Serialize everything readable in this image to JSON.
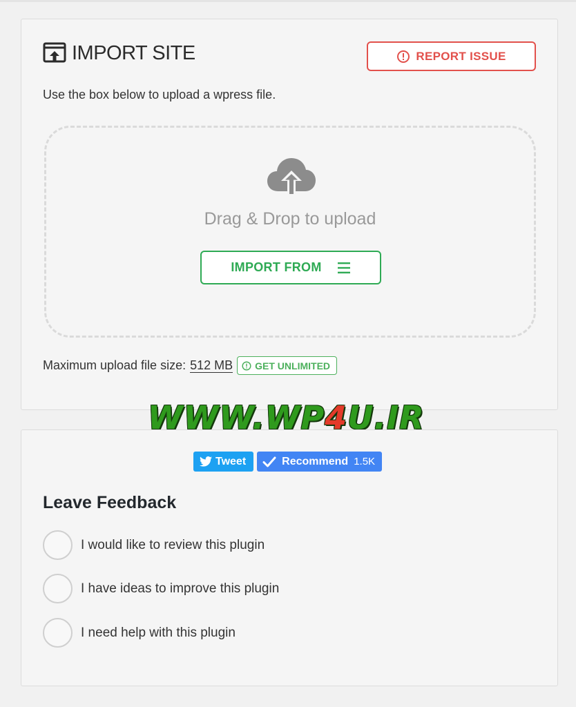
{
  "import": {
    "title": "IMPORT SITE",
    "report_issue_label": "REPORT ISSUE",
    "instructions": "Use the box below to upload a wpress file.",
    "dropzone_text": "Drag & Drop to upload",
    "import_from_label": "IMPORT FROM",
    "max_size_label": "Maximum upload file size:",
    "max_size_value": "512 MB",
    "get_unlimited_label": "GET UNLIMITED"
  },
  "watermark": {
    "text_a": "WWW.WP",
    "text_b": "4",
    "text_c": "U.IR"
  },
  "social": {
    "tweet_label": "Tweet",
    "recommend_label": "Recommend",
    "recommend_count": "1.5K"
  },
  "feedback": {
    "title": "Leave Feedback",
    "options": [
      {
        "label": "I would like to review this plugin"
      },
      {
        "label": "I have ideas to improve this plugin"
      },
      {
        "label": "I need help with this plugin"
      }
    ]
  },
  "colors": {
    "report_red": "#e2504b",
    "import_green": "#2eaa54",
    "unlimited_green": "#4cb05c",
    "twitter_blue": "#1da1f2",
    "recommend_blue": "#4285f4",
    "dropzone_border": "#dadada"
  },
  "icons": {
    "title": "import-screen-icon",
    "report": "exclamation-circle-icon",
    "dropzone": "cloud-upload-icon",
    "import_from": "hamburger-menu-icon",
    "unlimited": "exclamation-circle-icon",
    "tweet": "twitter-bird-icon",
    "recommend": "checkmark-icon"
  }
}
